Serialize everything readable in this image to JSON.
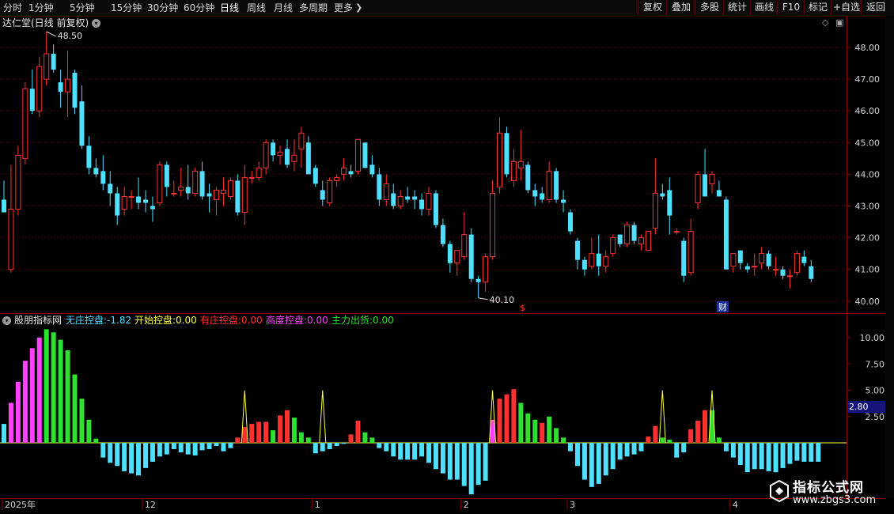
{
  "toolbar": {
    "periods": [
      "分时",
      "1分钟",
      "5分钟",
      "15分钟",
      "30分钟",
      "60分钟",
      "日线",
      "周线",
      "月线",
      "多周期",
      "更多"
    ],
    "active_period": "日线",
    "tools": [
      "复权",
      "叠加",
      "多股",
      "统计",
      "画线",
      "F10",
      "标记",
      "+自选",
      "返回"
    ]
  },
  "main_chart": {
    "stock_title": "达仁堂(日线 前复权)",
    "high_label": "48.50",
    "low_label": "40.10",
    "y_ticks": [
      "48.00",
      "47.00",
      "46.00",
      "45.00",
      "44.00",
      "43.00",
      "42.00",
      "41.00",
      "40.00"
    ],
    "markers": {
      "dividend": "$",
      "report": "财"
    }
  },
  "indicator": {
    "name": "股朋指标网",
    "lines": [
      {
        "label": "无庄控盘:",
        "value": "-1.82",
        "color": "#4fe0ff"
      },
      {
        "label": "开始控盘:",
        "value": "0.00",
        "color": "#ffff40"
      },
      {
        "label": "有庄控盘:",
        "value": "0.00",
        "color": "#ff3030"
      },
      {
        "label": "高度控盘:",
        "value": "0.00",
        "color": "#ff40ff"
      },
      {
        "label": "主力出货:",
        "value": "0.00",
        "color": "#30e030"
      }
    ],
    "y_ticks": [
      "10.00",
      "7.50",
      "5.00",
      "2.50"
    ],
    "current_value": "2.80"
  },
  "date_axis": {
    "labels": [
      "2025年",
      "12",
      "1",
      "2",
      "3",
      "4"
    ]
  },
  "watermark": {
    "title": "指标公式网",
    "url": "www.zbgs3.com"
  },
  "colors": {
    "up": "#ff3030",
    "down": "#4fe0ff",
    "magenta": "#ff40ff",
    "green": "#30e030",
    "yellow": "#ffff40",
    "frame": "#8a0000"
  },
  "chart_data": [
    {
      "type": "candlestick",
      "title": "达仁堂(日线 前复权)",
      "ylim": [
        39.8,
        48.8
      ],
      "candles_ohlc": [
        [
          43.2,
          43.8,
          42.9,
          42.8
        ],
        [
          41.0,
          44.3,
          40.9,
          42.9
        ],
        [
          42.9,
          44.9,
          42.7,
          44.6
        ],
        [
          44.5,
          46.9,
          44.3,
          46.7
        ],
        [
          46.7,
          47.3,
          45.9,
          46.0
        ],
        [
          46.0,
          47.7,
          45.8,
          47.4
        ],
        [
          47.0,
          48.5,
          46.8,
          47.8
        ],
        [
          47.8,
          48.1,
          47.2,
          47.3
        ],
        [
          46.9,
          47.3,
          46.1,
          46.6
        ],
        [
          46.6,
          47.9,
          45.8,
          47.0
        ],
        [
          47.2,
          47.3,
          45.9,
          46.1
        ],
        [
          46.3,
          46.8,
          44.8,
          44.9
        ],
        [
          44.9,
          45.2,
          44.0,
          44.2
        ],
        [
          44.2,
          44.5,
          43.9,
          44.0
        ],
        [
          44.1,
          44.6,
          43.5,
          43.7
        ],
        [
          43.7,
          44.1,
          43.0,
          43.4
        ],
        [
          43.4,
          43.6,
          42.4,
          42.7
        ],
        [
          42.9,
          43.6,
          42.7,
          43.3
        ],
        [
          43.3,
          43.5,
          42.9,
          43.3
        ],
        [
          43.3,
          43.9,
          42.9,
          43.1
        ],
        [
          43.2,
          43.5,
          42.8,
          43.1
        ],
        [
          43.0,
          43.3,
          42.5,
          42.9
        ],
        [
          43.1,
          44.4,
          43.0,
          44.3
        ],
        [
          44.3,
          44.4,
          43.3,
          43.6
        ],
        [
          43.4,
          43.8,
          43.3,
          43.4
        ],
        [
          43.5,
          44.2,
          43.3,
          43.6
        ],
        [
          43.6,
          44.3,
          43.2,
          43.4
        ],
        [
          43.4,
          44.2,
          43.3,
          44.1
        ],
        [
          44.1,
          44.4,
          43.2,
          43.3
        ],
        [
          43.4,
          43.7,
          42.8,
          43.3
        ],
        [
          43.2,
          43.6,
          42.7,
          43.5
        ],
        [
          43.4,
          43.9,
          43.0,
          43.5
        ],
        [
          43.3,
          43.9,
          43.2,
          43.8
        ],
        [
          43.8,
          44.0,
          42.7,
          42.8
        ],
        [
          42.8,
          44.3,
          42.4,
          43.9
        ],
        [
          43.9,
          44.1,
          43.7,
          43.9
        ],
        [
          43.9,
          44.4,
          43.8,
          44.2
        ],
        [
          44.2,
          45.1,
          44.0,
          45.0
        ],
        [
          45.0,
          45.1,
          44.4,
          44.6
        ],
        [
          44.6,
          44.9,
          44.3,
          44.7
        ],
        [
          44.8,
          45.1,
          44.2,
          44.3
        ],
        [
          44.4,
          45.1,
          44.1,
          44.6
        ],
        [
          44.8,
          45.5,
          44.2,
          45.3
        ],
        [
          45.0,
          45.2,
          44.0,
          44.0
        ],
        [
          44.2,
          44.3,
          43.6,
          43.7
        ],
        [
          43.5,
          43.8,
          43.0,
          43.2
        ],
        [
          43.1,
          43.9,
          43.0,
          43.8
        ],
        [
          43.8,
          44.0,
          43.6,
          43.9
        ],
        [
          44.0,
          44.5,
          43.8,
          44.2
        ],
        [
          44.1,
          44.3,
          43.9,
          44.0
        ],
        [
          44.1,
          45.1,
          44.0,
          45.1
        ],
        [
          45.0,
          45.0,
          44.2,
          44.2
        ],
        [
          44.3,
          44.6,
          43.9,
          44.0
        ],
        [
          44.0,
          44.2,
          43.0,
          43.2
        ],
        [
          43.2,
          44.0,
          43.0,
          43.7
        ],
        [
          43.4,
          43.7,
          42.9,
          43.0
        ],
        [
          43.0,
          43.5,
          42.9,
          43.3
        ],
        [
          43.3,
          43.6,
          43.1,
          43.2
        ],
        [
          43.3,
          43.5,
          42.9,
          43.2
        ],
        [
          43.2,
          43.4,
          42.7,
          42.9
        ],
        [
          42.9,
          43.6,
          42.7,
          43.4
        ],
        [
          43.4,
          43.5,
          42.3,
          42.4
        ],
        [
          42.4,
          42.6,
          41.7,
          41.8
        ],
        [
          41.8,
          41.9,
          40.9,
          41.2
        ],
        [
          41.2,
          41.6,
          40.8,
          41.6
        ],
        [
          41.4,
          42.8,
          41.3,
          42.1
        ],
        [
          42.1,
          42.3,
          40.6,
          40.7
        ],
        [
          40.7,
          40.8,
          40.1,
          40.6
        ],
        [
          40.6,
          41.5,
          40.3,
          41.4
        ],
        [
          41.4,
          43.8,
          41.3,
          43.4
        ],
        [
          43.6,
          45.8,
          43.4,
          45.3
        ],
        [
          45.3,
          45.5,
          43.9,
          44.0
        ],
        [
          43.8,
          44.8,
          43.6,
          44.4
        ],
        [
          44.2,
          45.4,
          43.8,
          44.4
        ],
        [
          44.3,
          44.4,
          43.4,
          43.5
        ],
        [
          43.5,
          43.7,
          43.0,
          43.3
        ],
        [
          43.4,
          43.6,
          43.1,
          43.2
        ],
        [
          43.2,
          44.4,
          43.1,
          44.1
        ],
        [
          44.1,
          44.2,
          43.1,
          43.2
        ],
        [
          43.2,
          43.5,
          42.8,
          43.1
        ],
        [
          42.8,
          42.9,
          42.1,
          42.2
        ],
        [
          41.9,
          42.0,
          41.0,
          41.3
        ],
        [
          41.3,
          41.4,
          40.8,
          41.0
        ],
        [
          41.1,
          42.0,
          41.0,
          41.5
        ],
        [
          41.5,
          42.1,
          40.8,
          41.1
        ],
        [
          41.1,
          41.6,
          40.9,
          41.4
        ],
        [
          41.5,
          42.1,
          41.4,
          42.0
        ],
        [
          42.1,
          42.1,
          41.7,
          41.8
        ],
        [
          41.8,
          42.5,
          41.7,
          42.4
        ],
        [
          42.4,
          42.5,
          41.8,
          41.9
        ],
        [
          41.8,
          42.1,
          41.6,
          42.0
        ],
        [
          41.6,
          42.2,
          41.6,
          42.2
        ],
        [
          42.3,
          44.5,
          42.1,
          43.4
        ],
        [
          43.4,
          43.7,
          43.2,
          43.3
        ],
        [
          43.5,
          43.9,
          42.1,
          42.7
        ],
        [
          42.2,
          42.3,
          42.1,
          42.2
        ],
        [
          41.9,
          42.0,
          40.6,
          40.8
        ],
        [
          40.9,
          42.6,
          40.8,
          42.2
        ],
        [
          43.1,
          44.1,
          42.9,
          44.0
        ],
        [
          44.0,
          44.8,
          43.4,
          43.3
        ],
        [
          43.7,
          44.1,
          43.4,
          44.0
        ],
        [
          43.5,
          43.8,
          43.3,
          43.3
        ],
        [
          43.2,
          43.3,
          41.0,
          41.0
        ],
        [
          41.1,
          41.5,
          40.9,
          41.5
        ],
        [
          41.6,
          41.6,
          41.0,
          41.2
        ],
        [
          41.1,
          41.2,
          40.9,
          41.0
        ],
        [
          41.1,
          41.5,
          40.8,
          41.1
        ],
        [
          41.2,
          41.7,
          41.0,
          41.5
        ],
        [
          41.5,
          41.6,
          41.0,
          41.1
        ],
        [
          41.0,
          41.4,
          40.8,
          41.0
        ],
        [
          41.0,
          41.1,
          40.7,
          40.8
        ],
        [
          40.8,
          41.0,
          40.4,
          40.8
        ],
        [
          40.9,
          41.6,
          40.8,
          41.5
        ],
        [
          41.4,
          41.6,
          41.1,
          41.2
        ],
        [
          41.1,
          41.3,
          40.6,
          40.7
        ]
      ]
    },
    {
      "type": "bar",
      "title": "股朋指标网",
      "ylim": [
        -4,
        12
      ],
      "series_names": [
        "无庄控盘",
        "开始控盘",
        "有庄控盘",
        "高度控盘",
        "主力出货"
      ],
      "values": [
        1.8,
        3.8,
        5.8,
        7.8,
        9.0,
        10.0,
        10.8,
        10.5,
        9.8,
        8.8,
        6.5,
        4.2,
        2.2,
        0.4,
        -1.4,
        -1.9,
        -2.2,
        -2.7,
        -2.9,
        -3.1,
        -2.4,
        -1.8,
        -1.3,
        -1.1,
        -0.6,
        -0.9,
        -1.1,
        -1.2,
        -0.7,
        -0.6,
        -0.3,
        -0.8,
        -0.5,
        0.5,
        1.5,
        1.8,
        2.0,
        2.0,
        1.2,
        2.6,
        3.1,
        2.4,
        1.0,
        0.5,
        -1.0,
        -0.8,
        -0.6,
        -0.3,
        -0.1,
        0.8,
        2.1,
        1.0,
        0.5,
        -0.5,
        -0.8,
        -1.3,
        -1.6,
        -1.6,
        -1.6,
        -1.3,
        -1.9,
        -2.5,
        -2.9,
        -3.5,
        -3.5,
        -4.1,
        -4.9,
        -4.0,
        -3.6,
        2.2,
        4.2,
        4.6,
        5.1,
        3.8,
        2.8,
        2.2,
        1.9,
        2.5,
        1.4,
        0.5,
        -0.8,
        -2.2,
        -3.5,
        -4.2,
        -3.9,
        -3.1,
        -2.5,
        -1.6,
        -1.3,
        -1.1,
        -0.8,
        0.6,
        1.6,
        0.5,
        0.3,
        -1.4,
        -0.9,
        1.3,
        2.1,
        3.1,
        3.1,
        0.5,
        -0.8,
        -1.4,
        -2.1,
        -2.8,
        -2.5,
        -2.5,
        -2.7,
        -2.8,
        -2.4,
        -2.0,
        -1.7,
        -1.8,
        -1.8,
        -1.8
      ],
      "colors_by_series": [
        "cyan",
        "magenta",
        "magenta",
        "magenta",
        "magenta",
        "magenta",
        "green",
        "green",
        "green",
        "green",
        "green",
        "green",
        "green",
        "green",
        "cyan",
        "cyan",
        "cyan",
        "cyan",
        "cyan",
        "cyan",
        "cyan",
        "cyan",
        "cyan",
        "cyan",
        "cyan",
        "cyan",
        "cyan",
        "cyan",
        "cyan",
        "cyan",
        "cyan",
        "cyan",
        "cyan",
        "red",
        "red",
        "red",
        "red",
        "red",
        "green",
        "red",
        "red",
        "green",
        "green",
        "green",
        "cyan",
        "cyan",
        "cyan",
        "cyan",
        "cyan",
        "red",
        "red",
        "green",
        "green",
        "cyan",
        "cyan",
        "cyan",
        "cyan",
        "cyan",
        "cyan",
        "cyan",
        "cyan",
        "cyan",
        "cyan",
        "cyan",
        "cyan",
        "cyan",
        "cyan",
        "cyan",
        "cyan",
        "magenta",
        "red",
        "red",
        "red",
        "green",
        "green",
        "green",
        "red",
        "green",
        "green",
        "green",
        "cyan",
        "cyan",
        "cyan",
        "cyan",
        "cyan",
        "cyan",
        "cyan",
        "cyan",
        "cyan",
        "cyan",
        "cyan",
        "red",
        "red",
        "green",
        "green",
        "cyan",
        "cyan",
        "red",
        "red",
        "red",
        "green",
        "green",
        "cyan",
        "cyan",
        "cyan",
        "cyan",
        "cyan",
        "cyan",
        "cyan",
        "cyan",
        "cyan",
        "cyan",
        "cyan",
        "cyan",
        "cyan",
        "cyan"
      ],
      "yellow_spike_markers": [
        "Q34",
        "Q45",
        "Q69",
        "Q93",
        "Q100"
      ]
    }
  ]
}
